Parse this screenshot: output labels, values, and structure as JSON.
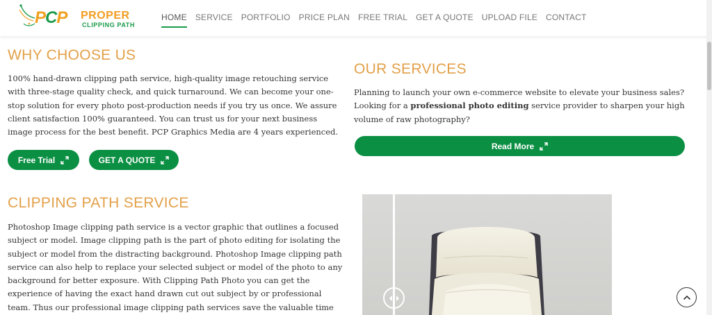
{
  "brand": {
    "logo_mark": "PCP",
    "logo_name": "PROPER",
    "logo_tagline": "CLIPPING PATH"
  },
  "nav": {
    "items": [
      {
        "label": "HOME",
        "active": true
      },
      {
        "label": "SERVICE"
      },
      {
        "label": "PORTFOLIO"
      },
      {
        "label": "PRICE PLAN"
      },
      {
        "label": "FREE TRIAL"
      },
      {
        "label": "GET A QUOTE"
      },
      {
        "label": "UPLOAD FILE"
      },
      {
        "label": "CONTACT"
      }
    ]
  },
  "why": {
    "title": "WHY CHOOSE US",
    "text": "100% hand-drawn clipping path service, high-quality image retouching service with three-stage quality check, and quick turnaround. We can become your one-stop solution for every photo post-production needs if you try us once. We assure client satisfaction 100% guaranteed. You can trust us for your next business image process for the best benefit. PCP Graphics Media are 4 years experienced.",
    "free_trial_label": "Free Trial",
    "quote_label": "GET A QUOTE"
  },
  "services": {
    "title": "OUR SERVICES",
    "text_before": "Planning to launch your own e-commerce website to elevate your business sales? Looking for a ",
    "text_bold": "professional photo editing",
    "text_after": " service provider to sharpen your high volume of raw photography?",
    "read_more_label": "Read More"
  },
  "clipping": {
    "title": "CLIPPING PATH SERVICE",
    "text": "Photoshop Image clipping path service is a vector graphic that outlines a focused subject or model. Image clipping path is the part of photo editing for isolating the subject or model from the distracting background. Photoshop Image clipping path service can also help to replace your selected subject or model of the photo to any background for better exposure. With Clipping Path Photo you can get the experience of having the exact hand drawn cut out subject by or professional team. Thus our professional image clipping path services save the valuable time you could be using on"
  },
  "icons": {
    "expand": "expand-arrows-icon",
    "compare_handle": "left-right-arrows-icon",
    "back_to_top": "chevron-up-icon"
  },
  "colors": {
    "accent_green": "#0b8f43",
    "heading_orange": "#e3a049",
    "logo_orange": "#f39c1f",
    "logo_green": "#1a9a4a"
  }
}
